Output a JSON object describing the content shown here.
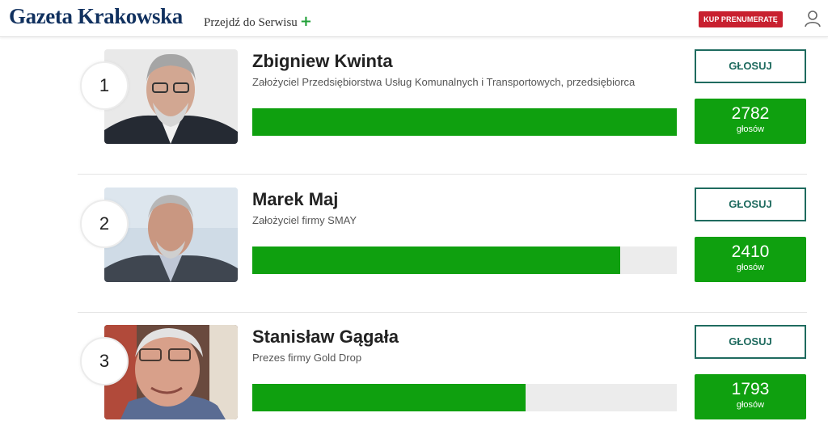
{
  "header": {
    "logo": "Gazeta Krakowska",
    "service_link": "Przejdź do Serwisu",
    "service_link_icon": "plus-icon",
    "subscribe_label": "KUP PRENUMERATĘ",
    "user_icon": "user-icon"
  },
  "candidates": [
    {
      "rank": "1",
      "name": "Zbigniew Kwinta",
      "description": "Założyciel Przedsiębiorstwa Usług Komunalnych i Transportowych, przedsiębiorca",
      "votes": "2782",
      "votes_label": "głosów",
      "vote_button": "GŁOSUJ",
      "bar_fraction": 1.0
    },
    {
      "rank": "2",
      "name": "Marek Maj",
      "description": "Założyciel firmy SMAY",
      "votes": "2410",
      "votes_label": "głosów",
      "vote_button": "GŁOSUJ",
      "bar_fraction": 0.866
    },
    {
      "rank": "3",
      "name": "Stanisław Gągała",
      "description": "Prezes firmy Gold Drop",
      "votes": "1793",
      "votes_label": "głosów",
      "vote_button": "GŁOSUJ",
      "bar_fraction": 0.644
    }
  ],
  "colors": {
    "brand": "#11315f",
    "subscribe": "#c8202f",
    "accent_green": "#0fa00f",
    "vote_border": "#1f6b5f"
  }
}
